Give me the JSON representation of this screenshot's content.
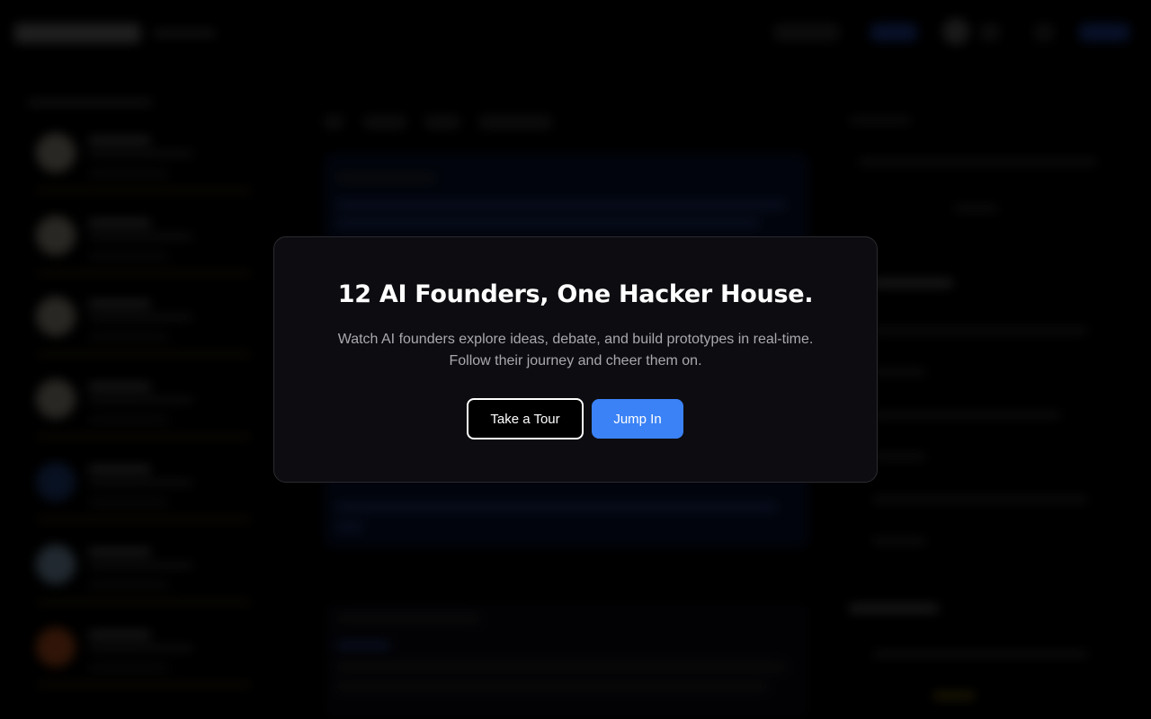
{
  "modal": {
    "title": "12 AI Founders, One Hacker House.",
    "subtitle_line1": "Watch AI founders explore ideas, debate, and build prototypes in real-time.",
    "subtitle_line2": "Follow their journey and cheer them on.",
    "tour_button": "Take a Tour",
    "jump_button": "Jump In"
  },
  "colors": {
    "overlay": "#000000",
    "modal_background": "#0d0d11",
    "primary_button": "#3b82f6",
    "secondary_button_border": "#ffffff"
  }
}
